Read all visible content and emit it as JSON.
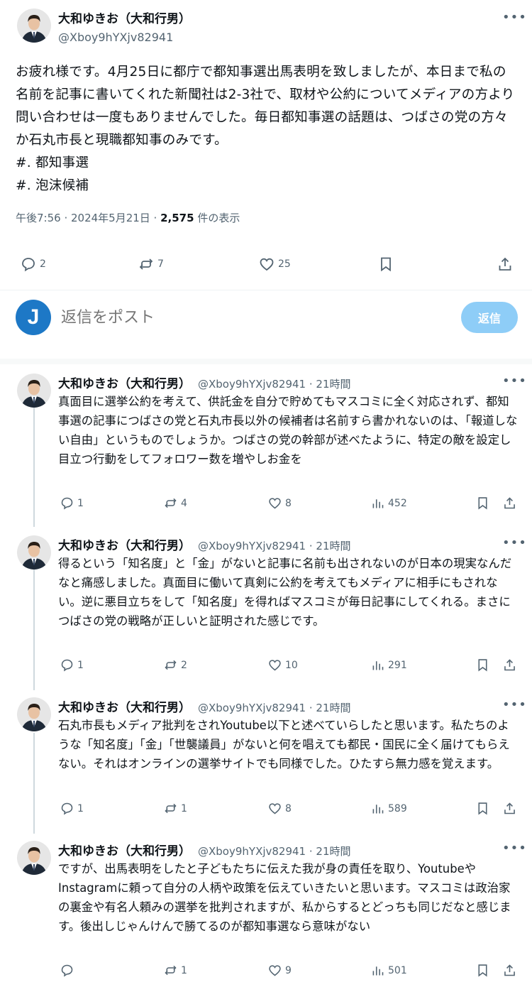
{
  "main_tweet": {
    "author_name": "大和ゆきお（大和行男）",
    "author_handle": "@Xboy9hYXjv82941",
    "text": "お疲れ様です。4月25日に都庁で都知事選出馬表明を致しましたが、本日まで私の名前を記事に書いてくれた新聞社は2-3社で、取材や公約についてメディアの方より問い合わせは一度もありませんでした。毎日都知事選の話題は、つばさの党の方々か石丸市長と現職都知事のみです。\n#. 都知事選\n#. 泡沫候補",
    "time": "午後7:56 · 2024年5月21日 · ",
    "views": "2,575",
    "views_suffix": " 件の表示",
    "replies": "2",
    "reposts": "7",
    "likes": "25"
  },
  "reply_bar": {
    "avatar_letter": "J",
    "placeholder": "返信をポスト",
    "button_label": "返信"
  },
  "replies": [
    {
      "author_name": "大和ゆきお（大和行男）",
      "author_handle": "@Xboy9hYXjv82941 · 21時間",
      "text": "真面目に選挙公約を考えて、供託金を自分で貯めてもマスコミに全く対応されず、都知事選の記事につばさの党と石丸市長以外の候補者は名前すら書かれないのは、「報道しない自由」というものでしょうか。つばさの党の幹部が述べたように、特定の敵を設定し目立つ行動をしてフォロワー数を増やしお金を",
      "replies": "1",
      "reposts": "4",
      "likes": "8",
      "views": "452"
    },
    {
      "author_name": "大和ゆきお（大和行男）",
      "author_handle": "@Xboy9hYXjv82941 · 21時間",
      "text": "得るという「知名度」と「金」がないと記事に名前も出されないのが日本の現実なんだなと痛感しました。真面目に働いて真剣に公約を考えてもメディアに相手にもされない。逆に悪目立ちをして「知名度」を得ればマスコミが毎日記事にしてくれる。まさにつばさの党の戦略が正しいと証明された感じです。",
      "replies": "1",
      "reposts": "2",
      "likes": "10",
      "views": "291"
    },
    {
      "author_name": "大和ゆきお（大和行男）",
      "author_handle": "@Xboy9hYXjv82941 · 21時間",
      "text": "石丸市長もメディア批判をされYoutube以下と述べていらしたと思います。私たちのような「知名度」「金」「世襲議員」がないと何を唱えても都民・国民に全く届けてもらえない。それはオンラインの選挙サイトでも同様でした。ひたすら無力感を覚えます。",
      "replies": "1",
      "reposts": "1",
      "likes": "8",
      "views": "589"
    },
    {
      "author_name": "大和ゆきお（大和行男）",
      "author_handle": "@Xboy9hYXjv82941 · 21時間",
      "text": "ですが、出馬表明をしたと子どもたちに伝えた我が身の責任を取り、YoutubeやInstagramに頼って自分の人柄や政策を伝えていきたいと思います。マスコミは政治家の裏金や有名人頼みの選挙を批判されますが、私からするとどっちも同じだなと感じます。後出しじゃんけんで勝てるのが都知事選なら意味がない",
      "replies": "",
      "reposts": "1",
      "likes": "9",
      "views": "501"
    }
  ],
  "icons": {
    "more": "more-icon",
    "reply": "reply-icon",
    "repost": "repost-icon",
    "like": "like-icon",
    "views": "views-icon",
    "bookmark": "bookmark-icon",
    "share": "share-icon"
  },
  "colors": {
    "text": "#0f1419",
    "secondary": "#536471",
    "reply_button": "#8ecdf7",
    "avatar_j": "#1d78c6",
    "divider": "#eff3f4",
    "thread_line": "#cfd9de"
  }
}
